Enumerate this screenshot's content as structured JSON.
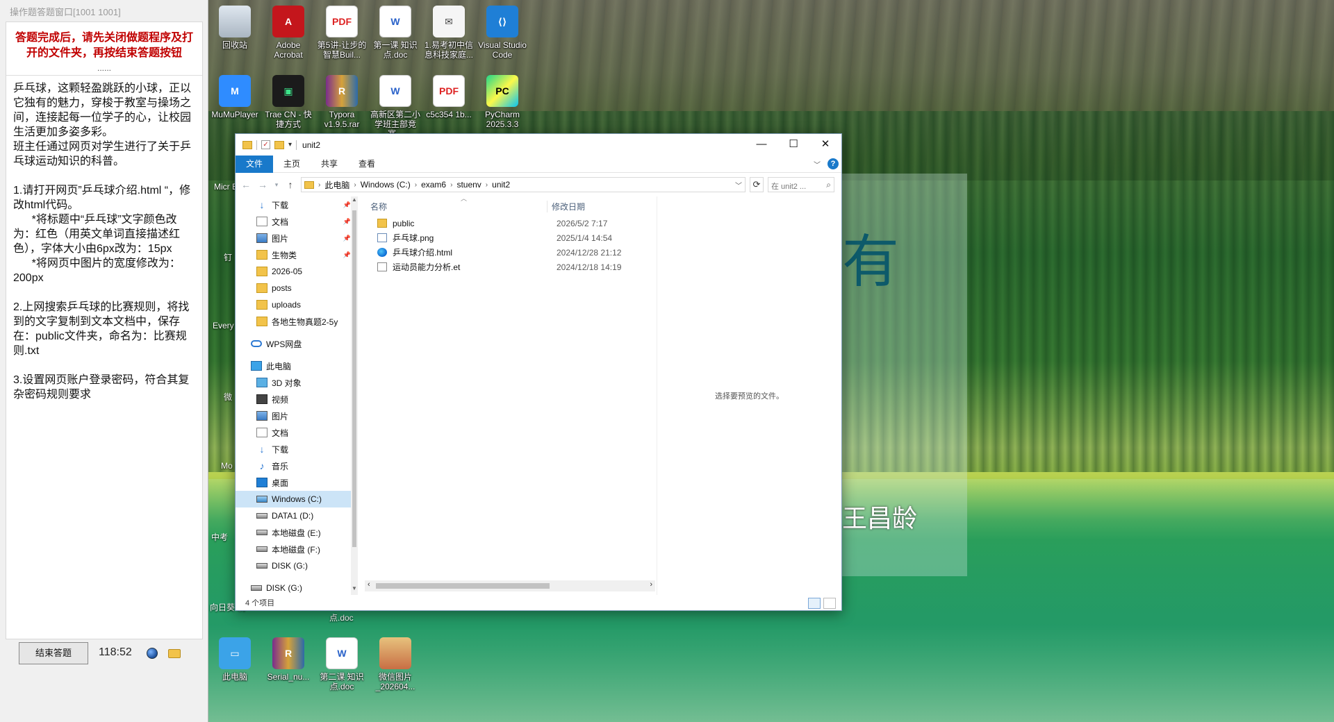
{
  "exam_panel": {
    "title": "操作题答题窗口[1001  1001]",
    "warning": "答题完成后，请先关闭做题程序及打开的文件夹，再按结束答题按钮",
    "dots": "......",
    "instructions": "乒乓球，这颗轻盈跳跃的小球，正以它独有的魅力，穿梭于教室与操场之间，连接起每一位学子的心，让校园生活更加多姿多彩。\n班主任通过网页对学生进行了关于乒乓球运动知识的科普。\n\n1.请打开网页”乒乓球介绍.html “，修改html代码。\n      *将标题中“乒乓球”文字颜色改为：红色（用英文单词直接描述红色），字体大小由6px改为：15px\n      *将网页中图片的宽度修改为：200px\n\n2.上网搜索乒乓球的比赛规则，将找到的文字复制到文本文档中，保存在：public文件夹，命名为：比赛规则.txt\n\n3.设置网页账户登录密码，符合其复杂密码规则要求",
    "end_button": "结束答题",
    "time": "118:52"
  },
  "desktop": {
    "icons_top": [
      {
        "label": "回收站",
        "icon": "recycle-bin-icon"
      },
      {
        "label": "Adobe Acrobat",
        "icon": "acrobat-icon",
        "glyph": "A"
      },
      {
        "label": "第5讲-让步的智慧Buil...",
        "icon": "pdf-file-icon",
        "glyph": "PDF"
      },
      {
        "label": "第一课 知识点.doc",
        "icon": "word-doc-icon",
        "glyph": "W"
      },
      {
        "label": "1.易考初中信息科技家庭...",
        "icon": "mail-app-icon",
        "glyph": "✉"
      },
      {
        "label": "Visual Studio Code",
        "icon": "vscode-icon",
        "glyph": "⟨⟩"
      }
    ],
    "icons_row2": [
      {
        "label": "MuMuPlayer",
        "icon": "mumu-icon",
        "glyph": "M"
      },
      {
        "label": "Trae CN - 快捷方式",
        "icon": "trae-icon",
        "glyph": "▣"
      },
      {
        "label": "Typora v1.9.5.rar",
        "icon": "winrar-icon",
        "glyph": "R"
      },
      {
        "label": "高新区第二小学班主部竞赛...",
        "icon": "word-doc-icon",
        "glyph": "W"
      },
      {
        "label": "c5c354 1b...",
        "icon": "pdf-file-icon",
        "glyph": "PDF"
      },
      {
        "label": "PyCharm 2025.3.3",
        "icon": "pycharm-icon",
        "glyph": "PC"
      }
    ],
    "icons_bottom": [
      {
        "label": "此电脑",
        "icon": "this-pc-icon",
        "glyph": "▭"
      },
      {
        "label": "Serial_nu...",
        "icon": "winrar-icon",
        "glyph": "R"
      },
      {
        "label": "第二课 知识点.doc",
        "icon": "word-doc-icon",
        "glyph": "W"
      },
      {
        "label": "微信图片_202604...",
        "icon": "image-file-icon",
        "glyph": ""
      }
    ],
    "partial_labels": [
      "Micr Ed",
      "钉",
      "Every",
      "微",
      "Mo Rec",
      "中考",
      "向日葵 制",
      "点.doc"
    ],
    "wallpaper_text_1": "有",
    "wallpaper_text_2": "王昌龄"
  },
  "explorer": {
    "title": "unit2",
    "ribbon_tabs": [
      "文件",
      "主页",
      "共享",
      "查看"
    ],
    "breadcrumb": [
      "此电脑",
      "Windows (C:)",
      "exam6",
      "stuenv",
      "unit2"
    ],
    "search_placeholder": "在 unit2 ...",
    "nav_items": [
      {
        "label": "下载",
        "icon": "download-icon",
        "pinned": true
      },
      {
        "label": "文档",
        "icon": "documents-icon",
        "pinned": true
      },
      {
        "label": "图片",
        "icon": "pictures-icon",
        "pinned": true
      },
      {
        "label": "生物类",
        "icon": "folder-icon",
        "pinned": true
      },
      {
        "label": "2026-05",
        "icon": "folder-icon"
      },
      {
        "label": "posts",
        "icon": "folder-icon"
      },
      {
        "label": "uploads",
        "icon": "folder-icon"
      },
      {
        "label": "各地生物真题2-5y",
        "icon": "folder-icon"
      },
      {
        "label": "WPS网盘",
        "icon": "cloud-icon"
      },
      {
        "label": "此电脑",
        "icon": "this-pc-icon"
      },
      {
        "label": "3D 对象",
        "icon": "3d-objects-icon"
      },
      {
        "label": "视频",
        "icon": "videos-icon"
      },
      {
        "label": "图片",
        "icon": "pictures-icon"
      },
      {
        "label": "文档",
        "icon": "documents-icon"
      },
      {
        "label": "下载",
        "icon": "download-icon"
      },
      {
        "label": "音乐",
        "icon": "music-icon"
      },
      {
        "label": "桌面",
        "icon": "desktop-icon"
      },
      {
        "label": "Windows (C:)",
        "icon": "windows-drive-icon",
        "selected": true
      },
      {
        "label": "DATA1 (D:)",
        "icon": "drive-icon"
      },
      {
        "label": "本地磁盘 (E:)",
        "icon": "drive-icon"
      },
      {
        "label": "本地磁盘 (F:)",
        "icon": "drive-icon"
      },
      {
        "label": "DISK (G:)",
        "icon": "drive-icon"
      },
      {
        "label": "DISK (G:)",
        "icon": "drive-icon"
      }
    ],
    "columns": {
      "name": "名称",
      "date": "修改日期"
    },
    "files": [
      {
        "name": "public",
        "date": "2026/5/2 7:17",
        "icon": "folder-icon"
      },
      {
        "name": "乒乓球.png",
        "date": "2025/1/4 14:54",
        "icon": "png-file-icon"
      },
      {
        "name": "乒乓球介绍.html",
        "date": "2024/12/28 21:12",
        "icon": "edge-html-icon"
      },
      {
        "name": "运动员能力分析.et",
        "date": "2024/12/18 14:19",
        "icon": "spreadsheet-file-icon"
      }
    ],
    "preview_text": "选择要预览的文件。",
    "status_text": "4 个项目"
  }
}
